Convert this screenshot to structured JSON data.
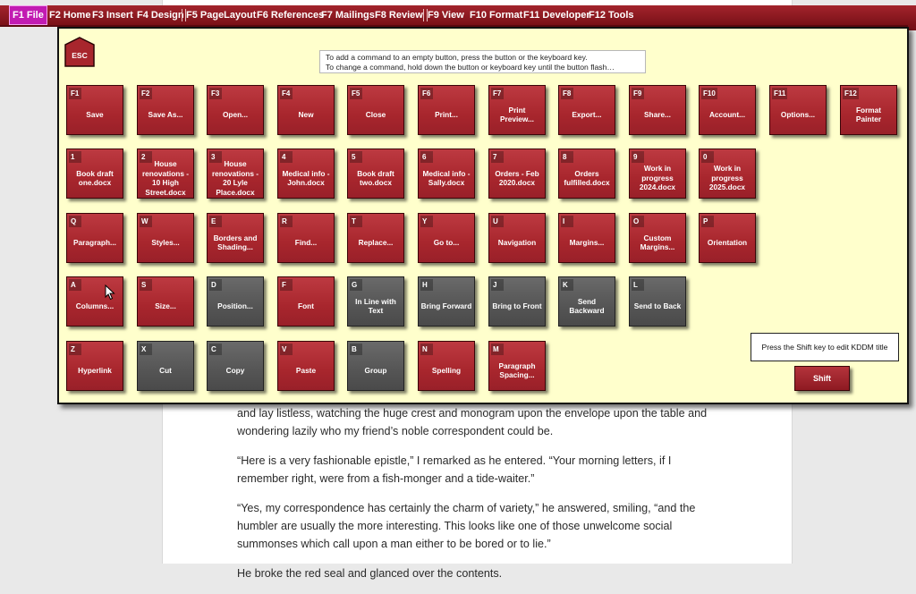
{
  "menu": {
    "items": [
      {
        "label": "F1 File",
        "active": true
      },
      {
        "label": "F2 Home"
      },
      {
        "label": "F3 Insert"
      },
      {
        "label": "F4 Design"
      },
      {
        "label": "F5 PageLayout"
      },
      {
        "label": "F6 References"
      },
      {
        "label": "F7 Mailings"
      },
      {
        "label": "F8 Review"
      },
      {
        "label": "F9 View"
      },
      {
        "label": "F10 Format"
      },
      {
        "label": "F11 Developer"
      },
      {
        "label": "F12 Tools"
      }
    ]
  },
  "panel": {
    "esc_label": "ESC",
    "hint_line1": "To add a command to an empty button, press the button or the keyboard key.",
    "hint_line2": "To change a command, hold down the button or keyboard key until the button flash…",
    "shift_hint": "Press the Shift key to edit KDDM title",
    "shift_label": "Shift"
  },
  "keys": [
    {
      "key": "F1",
      "label": "Save",
      "style": "red"
    },
    {
      "key": "F2",
      "label": "Save As...",
      "style": "red"
    },
    {
      "key": "F3",
      "label": "Open...",
      "style": "red"
    },
    {
      "key": "F4",
      "label": "New",
      "style": "red"
    },
    {
      "key": "F5",
      "label": "Close",
      "style": "red"
    },
    {
      "key": "F6",
      "label": "Print...",
      "style": "red"
    },
    {
      "key": "F7",
      "label": "Print Preview...",
      "style": "red"
    },
    {
      "key": "F8",
      "label": "Export...",
      "style": "red"
    },
    {
      "key": "F9",
      "label": "Share...",
      "style": "red"
    },
    {
      "key": "F10",
      "label": "Account...",
      "style": "red"
    },
    {
      "key": "F11",
      "label": "Options...",
      "style": "red"
    },
    {
      "key": "F12",
      "label": "Format Painter",
      "style": "red"
    },
    {
      "key": "1",
      "label": "Book draft one.docx",
      "style": "red"
    },
    {
      "key": "2",
      "label": "House renovations - 10 High Street.docx",
      "style": "red"
    },
    {
      "key": "3",
      "label": "House renovations - 20 Lyle Place.docx",
      "style": "red"
    },
    {
      "key": "4",
      "label": "Medical info - John.docx",
      "style": "red"
    },
    {
      "key": "5",
      "label": "Book draft two.docx",
      "style": "red"
    },
    {
      "key": "6",
      "label": "Medical info - Sally.docx",
      "style": "red"
    },
    {
      "key": "7",
      "label": "Orders - Feb 2020.docx",
      "style": "red"
    },
    {
      "key": "8",
      "label": "Orders fulfilled.docx",
      "style": "red"
    },
    {
      "key": "9",
      "label": "Work in progress 2024.docx",
      "style": "red"
    },
    {
      "key": "0",
      "label": "Work in progress 2025.docx",
      "style": "red"
    },
    {
      "key": "Q",
      "label": "Paragraph...",
      "style": "red"
    },
    {
      "key": "W",
      "label": "Styles...",
      "style": "red"
    },
    {
      "key": "E",
      "label": "Borders and Shading...",
      "style": "red"
    },
    {
      "key": "R",
      "label": "Find...",
      "style": "red"
    },
    {
      "key": "T",
      "label": "Replace...",
      "style": "red"
    },
    {
      "key": "Y",
      "label": "Go to...",
      "style": "red"
    },
    {
      "key": "U",
      "label": "Navigation",
      "style": "red"
    },
    {
      "key": "I",
      "label": "Margins...",
      "style": "red"
    },
    {
      "key": "O",
      "label": "Custom Margins...",
      "style": "red"
    },
    {
      "key": "P",
      "label": "Orientation",
      "style": "red"
    },
    {
      "key": "A",
      "label": "Columns...",
      "style": "red"
    },
    {
      "key": "S",
      "label": "Size...",
      "style": "red"
    },
    {
      "key": "D",
      "label": "Position...",
      "style": "gray"
    },
    {
      "key": "F",
      "label": "Font",
      "style": "red"
    },
    {
      "key": "G",
      "label": "In Line with Text",
      "style": "gray"
    },
    {
      "key": "H",
      "label": "Bring Forward",
      "style": "gray"
    },
    {
      "key": "J",
      "label": "Bring to Front",
      "style": "gray"
    },
    {
      "key": "K",
      "label": "Send Backward",
      "style": "gray"
    },
    {
      "key": "L",
      "label": "Send to Back",
      "style": "gray"
    },
    {
      "key": "Z",
      "label": "Hyperlink",
      "style": "red"
    },
    {
      "key": "X",
      "label": "Cut",
      "style": "gray"
    },
    {
      "key": "C",
      "label": "Copy",
      "style": "gray"
    },
    {
      "key": "V",
      "label": "Paste",
      "style": "red"
    },
    {
      "key": "B",
      "label": "Group",
      "style": "gray"
    },
    {
      "key": "N",
      "label": "Spelling",
      "style": "red"
    },
    {
      "key": "M",
      "label": "Paragraph Spacing...",
      "style": "red"
    }
  ],
  "document": {
    "paragraphs": [
      "and lay listless, watching the huge crest and monogram upon the envelope upon the table and wondering lazily who my friend’s noble correspondent could be.",
      "“Here is a very fashionable epistle,” I remarked as he entered. “Your morning letters, if I remember right, were from a fish-monger and a tide-waiter.”",
      "“Yes, my correspondence has certainly the charm of variety,” he answered, smiling, “and the humbler are usually the more interesting. This looks like one of those unwelcome social summonses which call upon a man either to be bored or to lie.”",
      "He broke the red seal and glanced over the contents."
    ]
  },
  "colors": {
    "menu_bar": "#8e1a22",
    "menu_active": "#c21bb2",
    "panel_bg": "#ffffcc",
    "key_red": "#a8262d",
    "key_gray": "#555555"
  }
}
